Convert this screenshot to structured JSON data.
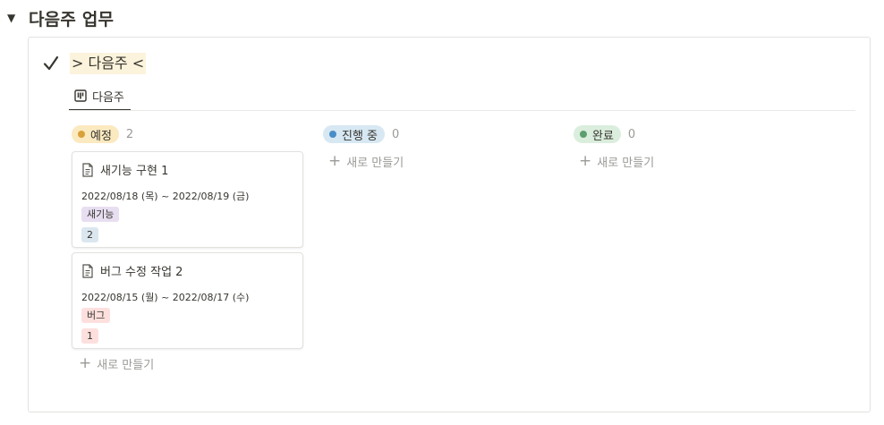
{
  "section": {
    "arrow": "▼",
    "title": "다음주 업무"
  },
  "callout": {
    "highlight_title": "> 다음주 <"
  },
  "view_tab": {
    "label": "다음주"
  },
  "columns": [
    {
      "status": "예정",
      "count": "2",
      "dot_color": "#d9a13a",
      "pill_bg": "#fbe9c0",
      "cards": [
        {
          "title": "새기능 구현 1",
          "date": "2022/08/18 (목) ~ 2022/08/19 (금)",
          "tag": "새기능",
          "tag_bg": "#e8def1",
          "num": "2",
          "num_bg": "#dbe7ef"
        },
        {
          "title": "버그 수정 작업 2",
          "date": "2022/08/15 (월) ~ 2022/08/17 (수)",
          "tag": "버그",
          "tag_bg": "#fde0de",
          "num": "1",
          "num_bg": "#fde0de"
        }
      ],
      "new_label": "새로 만들기"
    },
    {
      "status": "진행 중",
      "count": "0",
      "dot_color": "#4a8dc7",
      "pill_bg": "#d7e8f3",
      "new_label": "새로 만들기"
    },
    {
      "status": "완료",
      "count": "0",
      "dot_color": "#5e9e6e",
      "pill_bg": "#dbeede",
      "new_label": "새로 만들기"
    }
  ],
  "colors": {
    "text": "#37352f",
    "muted": "#9b9a97",
    "border": "#e3e2e0"
  }
}
